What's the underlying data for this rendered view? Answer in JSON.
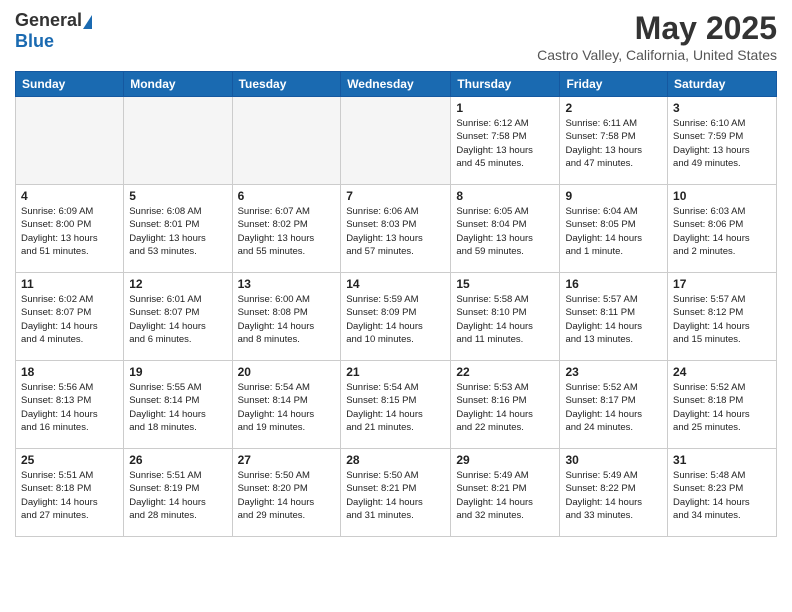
{
  "header": {
    "logo_general": "General",
    "logo_blue": "Blue",
    "month": "May 2025",
    "location": "Castro Valley, California, United States"
  },
  "days_of_week": [
    "Sunday",
    "Monday",
    "Tuesday",
    "Wednesday",
    "Thursday",
    "Friday",
    "Saturday"
  ],
  "weeks": [
    [
      {
        "day": "",
        "info": ""
      },
      {
        "day": "",
        "info": ""
      },
      {
        "day": "",
        "info": ""
      },
      {
        "day": "",
        "info": ""
      },
      {
        "day": "1",
        "info": "Sunrise: 6:12 AM\nSunset: 7:58 PM\nDaylight: 13 hours\nand 45 minutes."
      },
      {
        "day": "2",
        "info": "Sunrise: 6:11 AM\nSunset: 7:58 PM\nDaylight: 13 hours\nand 47 minutes."
      },
      {
        "day": "3",
        "info": "Sunrise: 6:10 AM\nSunset: 7:59 PM\nDaylight: 13 hours\nand 49 minutes."
      }
    ],
    [
      {
        "day": "4",
        "info": "Sunrise: 6:09 AM\nSunset: 8:00 PM\nDaylight: 13 hours\nand 51 minutes."
      },
      {
        "day": "5",
        "info": "Sunrise: 6:08 AM\nSunset: 8:01 PM\nDaylight: 13 hours\nand 53 minutes."
      },
      {
        "day": "6",
        "info": "Sunrise: 6:07 AM\nSunset: 8:02 PM\nDaylight: 13 hours\nand 55 minutes."
      },
      {
        "day": "7",
        "info": "Sunrise: 6:06 AM\nSunset: 8:03 PM\nDaylight: 13 hours\nand 57 minutes."
      },
      {
        "day": "8",
        "info": "Sunrise: 6:05 AM\nSunset: 8:04 PM\nDaylight: 13 hours\nand 59 minutes."
      },
      {
        "day": "9",
        "info": "Sunrise: 6:04 AM\nSunset: 8:05 PM\nDaylight: 14 hours\nand 1 minute."
      },
      {
        "day": "10",
        "info": "Sunrise: 6:03 AM\nSunset: 8:06 PM\nDaylight: 14 hours\nand 2 minutes."
      }
    ],
    [
      {
        "day": "11",
        "info": "Sunrise: 6:02 AM\nSunset: 8:07 PM\nDaylight: 14 hours\nand 4 minutes."
      },
      {
        "day": "12",
        "info": "Sunrise: 6:01 AM\nSunset: 8:07 PM\nDaylight: 14 hours\nand 6 minutes."
      },
      {
        "day": "13",
        "info": "Sunrise: 6:00 AM\nSunset: 8:08 PM\nDaylight: 14 hours\nand 8 minutes."
      },
      {
        "day": "14",
        "info": "Sunrise: 5:59 AM\nSunset: 8:09 PM\nDaylight: 14 hours\nand 10 minutes."
      },
      {
        "day": "15",
        "info": "Sunrise: 5:58 AM\nSunset: 8:10 PM\nDaylight: 14 hours\nand 11 minutes."
      },
      {
        "day": "16",
        "info": "Sunrise: 5:57 AM\nSunset: 8:11 PM\nDaylight: 14 hours\nand 13 minutes."
      },
      {
        "day": "17",
        "info": "Sunrise: 5:57 AM\nSunset: 8:12 PM\nDaylight: 14 hours\nand 15 minutes."
      }
    ],
    [
      {
        "day": "18",
        "info": "Sunrise: 5:56 AM\nSunset: 8:13 PM\nDaylight: 14 hours\nand 16 minutes."
      },
      {
        "day": "19",
        "info": "Sunrise: 5:55 AM\nSunset: 8:14 PM\nDaylight: 14 hours\nand 18 minutes."
      },
      {
        "day": "20",
        "info": "Sunrise: 5:54 AM\nSunset: 8:14 PM\nDaylight: 14 hours\nand 19 minutes."
      },
      {
        "day": "21",
        "info": "Sunrise: 5:54 AM\nSunset: 8:15 PM\nDaylight: 14 hours\nand 21 minutes."
      },
      {
        "day": "22",
        "info": "Sunrise: 5:53 AM\nSunset: 8:16 PM\nDaylight: 14 hours\nand 22 minutes."
      },
      {
        "day": "23",
        "info": "Sunrise: 5:52 AM\nSunset: 8:17 PM\nDaylight: 14 hours\nand 24 minutes."
      },
      {
        "day": "24",
        "info": "Sunrise: 5:52 AM\nSunset: 8:18 PM\nDaylight: 14 hours\nand 25 minutes."
      }
    ],
    [
      {
        "day": "25",
        "info": "Sunrise: 5:51 AM\nSunset: 8:18 PM\nDaylight: 14 hours\nand 27 minutes."
      },
      {
        "day": "26",
        "info": "Sunrise: 5:51 AM\nSunset: 8:19 PM\nDaylight: 14 hours\nand 28 minutes."
      },
      {
        "day": "27",
        "info": "Sunrise: 5:50 AM\nSunset: 8:20 PM\nDaylight: 14 hours\nand 29 minutes."
      },
      {
        "day": "28",
        "info": "Sunrise: 5:50 AM\nSunset: 8:21 PM\nDaylight: 14 hours\nand 31 minutes."
      },
      {
        "day": "29",
        "info": "Sunrise: 5:49 AM\nSunset: 8:21 PM\nDaylight: 14 hours\nand 32 minutes."
      },
      {
        "day": "30",
        "info": "Sunrise: 5:49 AM\nSunset: 8:22 PM\nDaylight: 14 hours\nand 33 minutes."
      },
      {
        "day": "31",
        "info": "Sunrise: 5:48 AM\nSunset: 8:23 PM\nDaylight: 14 hours\nand 34 minutes."
      }
    ]
  ]
}
